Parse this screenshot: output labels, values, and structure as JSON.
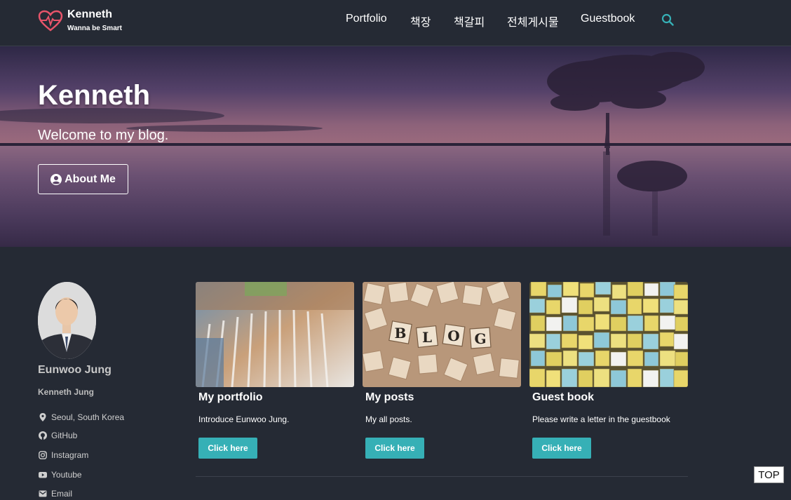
{
  "brand": {
    "title": "Kenneth",
    "subtitle": "Wanna be Smart",
    "logo_icon": "heart-pulse-icon",
    "logo_color": "#e8546a"
  },
  "nav": {
    "items": [
      {
        "label": "Portfolio"
      },
      {
        "label": "책장"
      },
      {
        "label": "책갈피"
      },
      {
        "label": "전체게시물"
      },
      {
        "label": "Guestbook"
      }
    ],
    "search_icon": "search-icon",
    "accent_color": "#36b0b6"
  },
  "hero": {
    "title": "Kenneth",
    "subtitle": "Welcome to my blog.",
    "about_button": "About Me",
    "about_icon": "user-circle-icon"
  },
  "profile": {
    "name": "Eunwoo Jung",
    "handle": "Kenneth Jung",
    "links": [
      {
        "icon": "map-marker-icon",
        "label": "Seoul, South Korea"
      },
      {
        "icon": "github-icon",
        "label": "GitHub"
      },
      {
        "icon": "instagram-icon",
        "label": "Instagram"
      },
      {
        "icon": "youtube-icon",
        "label": "Youtube"
      },
      {
        "icon": "envelope-icon",
        "label": "Email"
      }
    ]
  },
  "cards": [
    {
      "title": "My portfolio",
      "description": "Introduce Eunwoo Jung.",
      "button": "Click here"
    },
    {
      "title": "My posts",
      "description": "My all posts.",
      "button": "Click here",
      "image_letters": [
        "B",
        "L",
        "O",
        "G"
      ]
    },
    {
      "title": "Guest book",
      "description": "Please write a letter in the guestbook",
      "button": "Click here"
    }
  ],
  "top_button": "TOP"
}
